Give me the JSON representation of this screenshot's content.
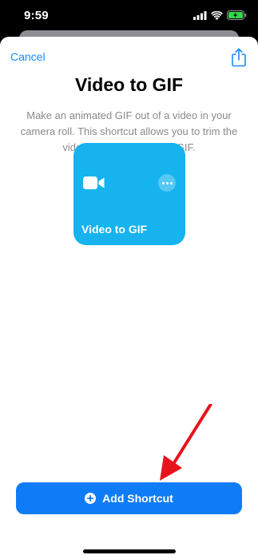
{
  "status_bar": {
    "time": "9:59",
    "icons": [
      "cellular-signal-icon",
      "wifi-icon",
      "battery-charging-icon"
    ]
  },
  "header": {
    "cancel_label": "Cancel",
    "share_icon": "share-icon"
  },
  "shortcut": {
    "title": "Video to GIF",
    "description": "Make an animated GIF out of a video in your camera roll. This shortcut allows you to trim the video before making the GIF.",
    "card_name": "Video to GIF",
    "card_color": "#16b3ee",
    "card_icon": "video-camera-icon"
  },
  "actions": {
    "add_label": "Add Shortcut",
    "add_icon": "plus-circle-icon",
    "button_color": "#0f7cf7"
  },
  "annotation": {
    "arrow_color": "#e8141b"
  }
}
